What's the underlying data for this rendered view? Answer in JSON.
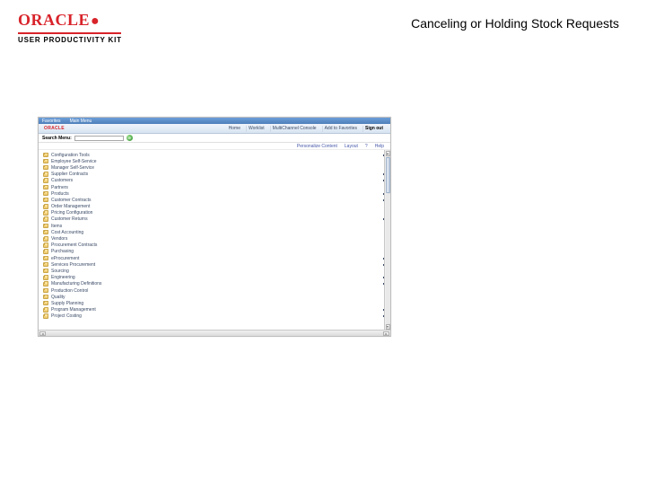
{
  "branding": {
    "vendor": "ORACLE",
    "product_line": "USER PRODUCTIVITY KIT"
  },
  "page": {
    "title": "Canceling or Holding Stock Requests"
  },
  "app": {
    "top_bar": {
      "left1": "Favorites",
      "left2": "Main Menu"
    },
    "brand": "ORACLE",
    "top_links": {
      "home": "Home",
      "worklist": "Worklist",
      "mcf": "MultiChannel Console",
      "favs": "Add to Favorites",
      "signout": "Sign out"
    },
    "search": {
      "label": "Search Menu:"
    },
    "personalize": {
      "content": "Personalize Content",
      "layout": "Layout",
      "help": "Help"
    },
    "menu": [
      {
        "label": "Configuration Tools",
        "expand": true
      },
      {
        "label": "Employee Self-Service",
        "expand": false
      },
      {
        "label": "Manager Self-Service",
        "expand": false
      },
      {
        "label": "Supplier Contracts",
        "expand": true
      },
      {
        "label": "Customers",
        "expand": true
      },
      {
        "label": "Partners",
        "expand": false
      },
      {
        "label": "Products",
        "expand": true
      },
      {
        "label": "Customer Contracts",
        "expand": true
      },
      {
        "label": "Order Management",
        "expand": false
      },
      {
        "label": "Pricing Configuration",
        "expand": false
      },
      {
        "label": "Customer Returns",
        "expand": true
      },
      {
        "label": "Items",
        "expand": false
      },
      {
        "label": "Cost Accounting",
        "expand": false
      },
      {
        "label": "Vendors",
        "expand": false
      },
      {
        "label": "Procurement Contracts",
        "expand": false
      },
      {
        "label": "Purchasing",
        "expand": false
      },
      {
        "label": "eProcurement",
        "expand": true
      },
      {
        "label": "Services Procurement",
        "expand": true
      },
      {
        "label": "Sourcing",
        "expand": false
      },
      {
        "label": "Engineering",
        "expand": true
      },
      {
        "label": "Manufacturing Definitions",
        "expand": true
      },
      {
        "label": "Production Control",
        "expand": false
      },
      {
        "label": "Quality",
        "expand": false
      },
      {
        "label": "Supply Planning",
        "expand": false
      },
      {
        "label": "Program Management",
        "expand": true
      },
      {
        "label": "Project Costing",
        "expand": true
      }
    ]
  }
}
